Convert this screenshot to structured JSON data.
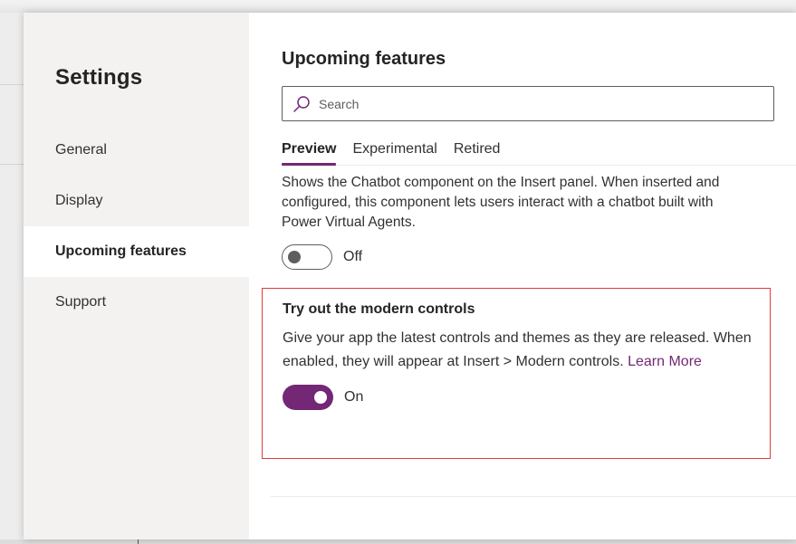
{
  "sidebar": {
    "title": "Settings",
    "items": [
      {
        "label": "General"
      },
      {
        "label": "Display"
      },
      {
        "label": "Upcoming features"
      },
      {
        "label": "Support"
      }
    ]
  },
  "main": {
    "title": "Upcoming features",
    "search": {
      "placeholder": "Search",
      "value": ""
    },
    "tabs": [
      {
        "label": "Preview"
      },
      {
        "label": "Experimental"
      },
      {
        "label": "Retired"
      }
    ],
    "chatbot_feature": {
      "description": "Shows the Chatbot component on the Insert panel. When inserted and configured, this component lets users interact with a chatbot built with Power Virtual Agents.",
      "toggle_state": "Off"
    },
    "modern_controls": {
      "title": "Try out the modern controls",
      "description": "Give your app the latest controls and themes as they are released. When enabled, they will appear at Insert > Modern controls.",
      "learn_more": "Learn More",
      "toggle_state": "On"
    }
  },
  "colors": {
    "accent": "#742774",
    "highlight_border": "#e33b3b",
    "sidebar_bg": "#f3f2f1"
  },
  "icons": {
    "search": "search-icon"
  }
}
